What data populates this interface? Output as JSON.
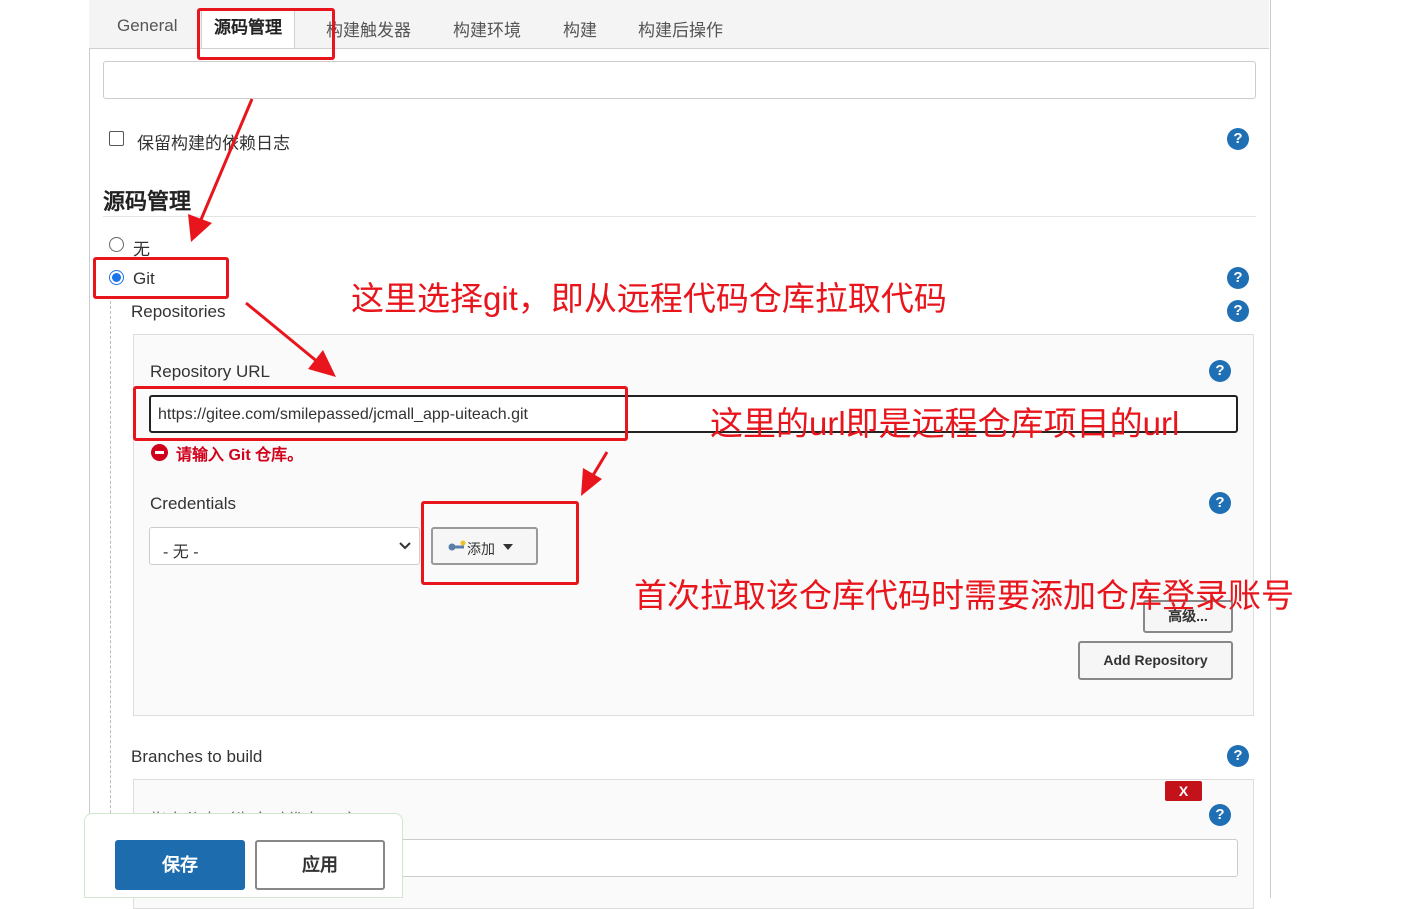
{
  "tabs": [
    "General",
    "源码管理",
    "构建触发器",
    "构建环境",
    "构建",
    "构建后操作"
  ],
  "keep_log_label": "保留构建的依赖日志",
  "section_title": "源码管理",
  "scm": {
    "none_label": "无",
    "git_label": "Git",
    "repositories_label": "Repositories",
    "repo_url_label": "Repository URL",
    "repo_url_value": "https://gitee.com/smilepassed/jcmall_app-uiteach.git",
    "error_text": "请输入 Git 仓库。",
    "credentials_label": "Credentials",
    "credentials_selected": "- 无 -",
    "add_button": "添加",
    "advanced_button": "高级...",
    "add_repository_button": "Add Repository",
    "branches_label": "Branches to build",
    "branch_spec_label": "指定分支（为空时代表any）",
    "delete_branch": "X"
  },
  "footer": {
    "save": "保存",
    "apply": "应用"
  },
  "help_glyph": "?",
  "annotations": {
    "git_note": "这里选择git，即从远程代码仓库拉取代码",
    "url_note": "这里的url即是远程仓库项目的url",
    "cred_note": "首次拉取该仓库代码时需要添加仓库登录账号"
  },
  "colors": {
    "accent": "#1f6fb5",
    "annotation": "#e8151c",
    "error": "#d0021b"
  }
}
